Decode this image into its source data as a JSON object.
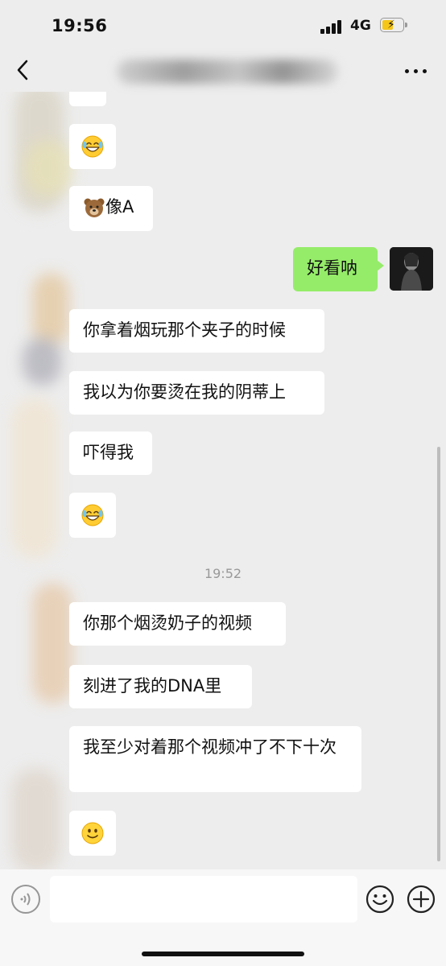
{
  "status_bar": {
    "time": "19:56",
    "network": "4G",
    "charging": true
  },
  "nav": {
    "back_icon": "chevron-left-icon",
    "more_icon": "more-dots-icon",
    "title_hidden": true
  },
  "messages": [
    {
      "side": "in",
      "emoji": "grin-sweat"
    },
    {
      "side": "in",
      "emoji": "bear",
      "text": "像A"
    },
    {
      "side": "out",
      "text": "好看呐"
    },
    {
      "side": "in",
      "text": "你拿着烟玩那个夹子的时候"
    },
    {
      "side": "in",
      "text": "我以为你要烫在我的阴蒂上"
    },
    {
      "side": "in",
      "text": "吓得我"
    },
    {
      "side": "in",
      "emoji": "grin-sweat"
    },
    {
      "side": "in",
      "text": "你那个烟烫奶子的视频"
    },
    {
      "side": "in",
      "text": "刻进了我的DNA里"
    },
    {
      "side": "in",
      "text": "我至少对着那个视频冲了不下十次"
    },
    {
      "side": "in",
      "emoji": "smile"
    }
  ],
  "timestamp": "19:52",
  "input_bar": {
    "voice_icon": "voice-icon",
    "emoji_icon": "emoji-icon",
    "plus_icon": "plus-circle-icon",
    "text_value": ""
  },
  "colors": {
    "background": "#ededed",
    "bubble_in": "#ffffff",
    "bubble_out": "#95ec69",
    "timestamp": "#999999"
  }
}
